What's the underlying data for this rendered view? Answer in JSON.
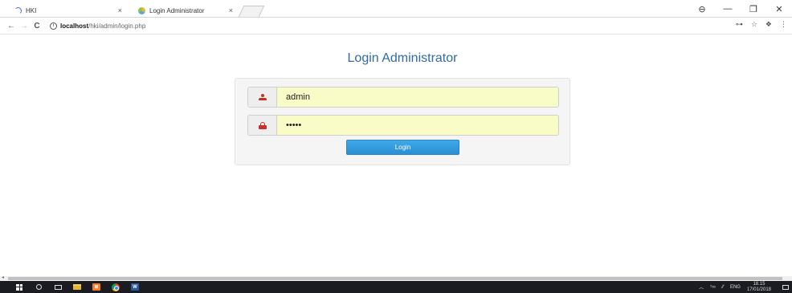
{
  "browser": {
    "tabs": [
      {
        "title": "HKI",
        "close": "×"
      },
      {
        "title": "Login Administrator",
        "close": "×"
      }
    ],
    "window_controls": {
      "profile": "⊖",
      "minimize": "—",
      "maximize": "❐",
      "close": "✕"
    },
    "nav": {
      "back": "←",
      "forward": "→",
      "reload": "C"
    },
    "address": {
      "info": "i",
      "host": "localhost",
      "path": "/hki/admin/login.php"
    },
    "toolbar_right": {
      "key": "⊶",
      "star": "☆",
      "ext": "❖",
      "menu": "⋮"
    }
  },
  "page": {
    "title": "Login Administrator",
    "username": {
      "value": "admin"
    },
    "password": {
      "value": "•••••"
    },
    "login_label": "Login"
  },
  "scrollbar": {
    "arrow": "◂"
  },
  "taskbar": {
    "xampp_label": "⊠",
    "word_label": "W",
    "tray": {
      "chevron": "︿",
      "wifi": "⁵∞",
      "pen": "⁄⁄",
      "lang": "ENG"
    },
    "clock": {
      "time": "18.15",
      "date": "17/01/2018"
    }
  },
  "colors": {
    "accent": "#2f6aa7",
    "button": "#2a8fd3",
    "icon": "#c9302c",
    "autofill": "#fafcc8"
  }
}
